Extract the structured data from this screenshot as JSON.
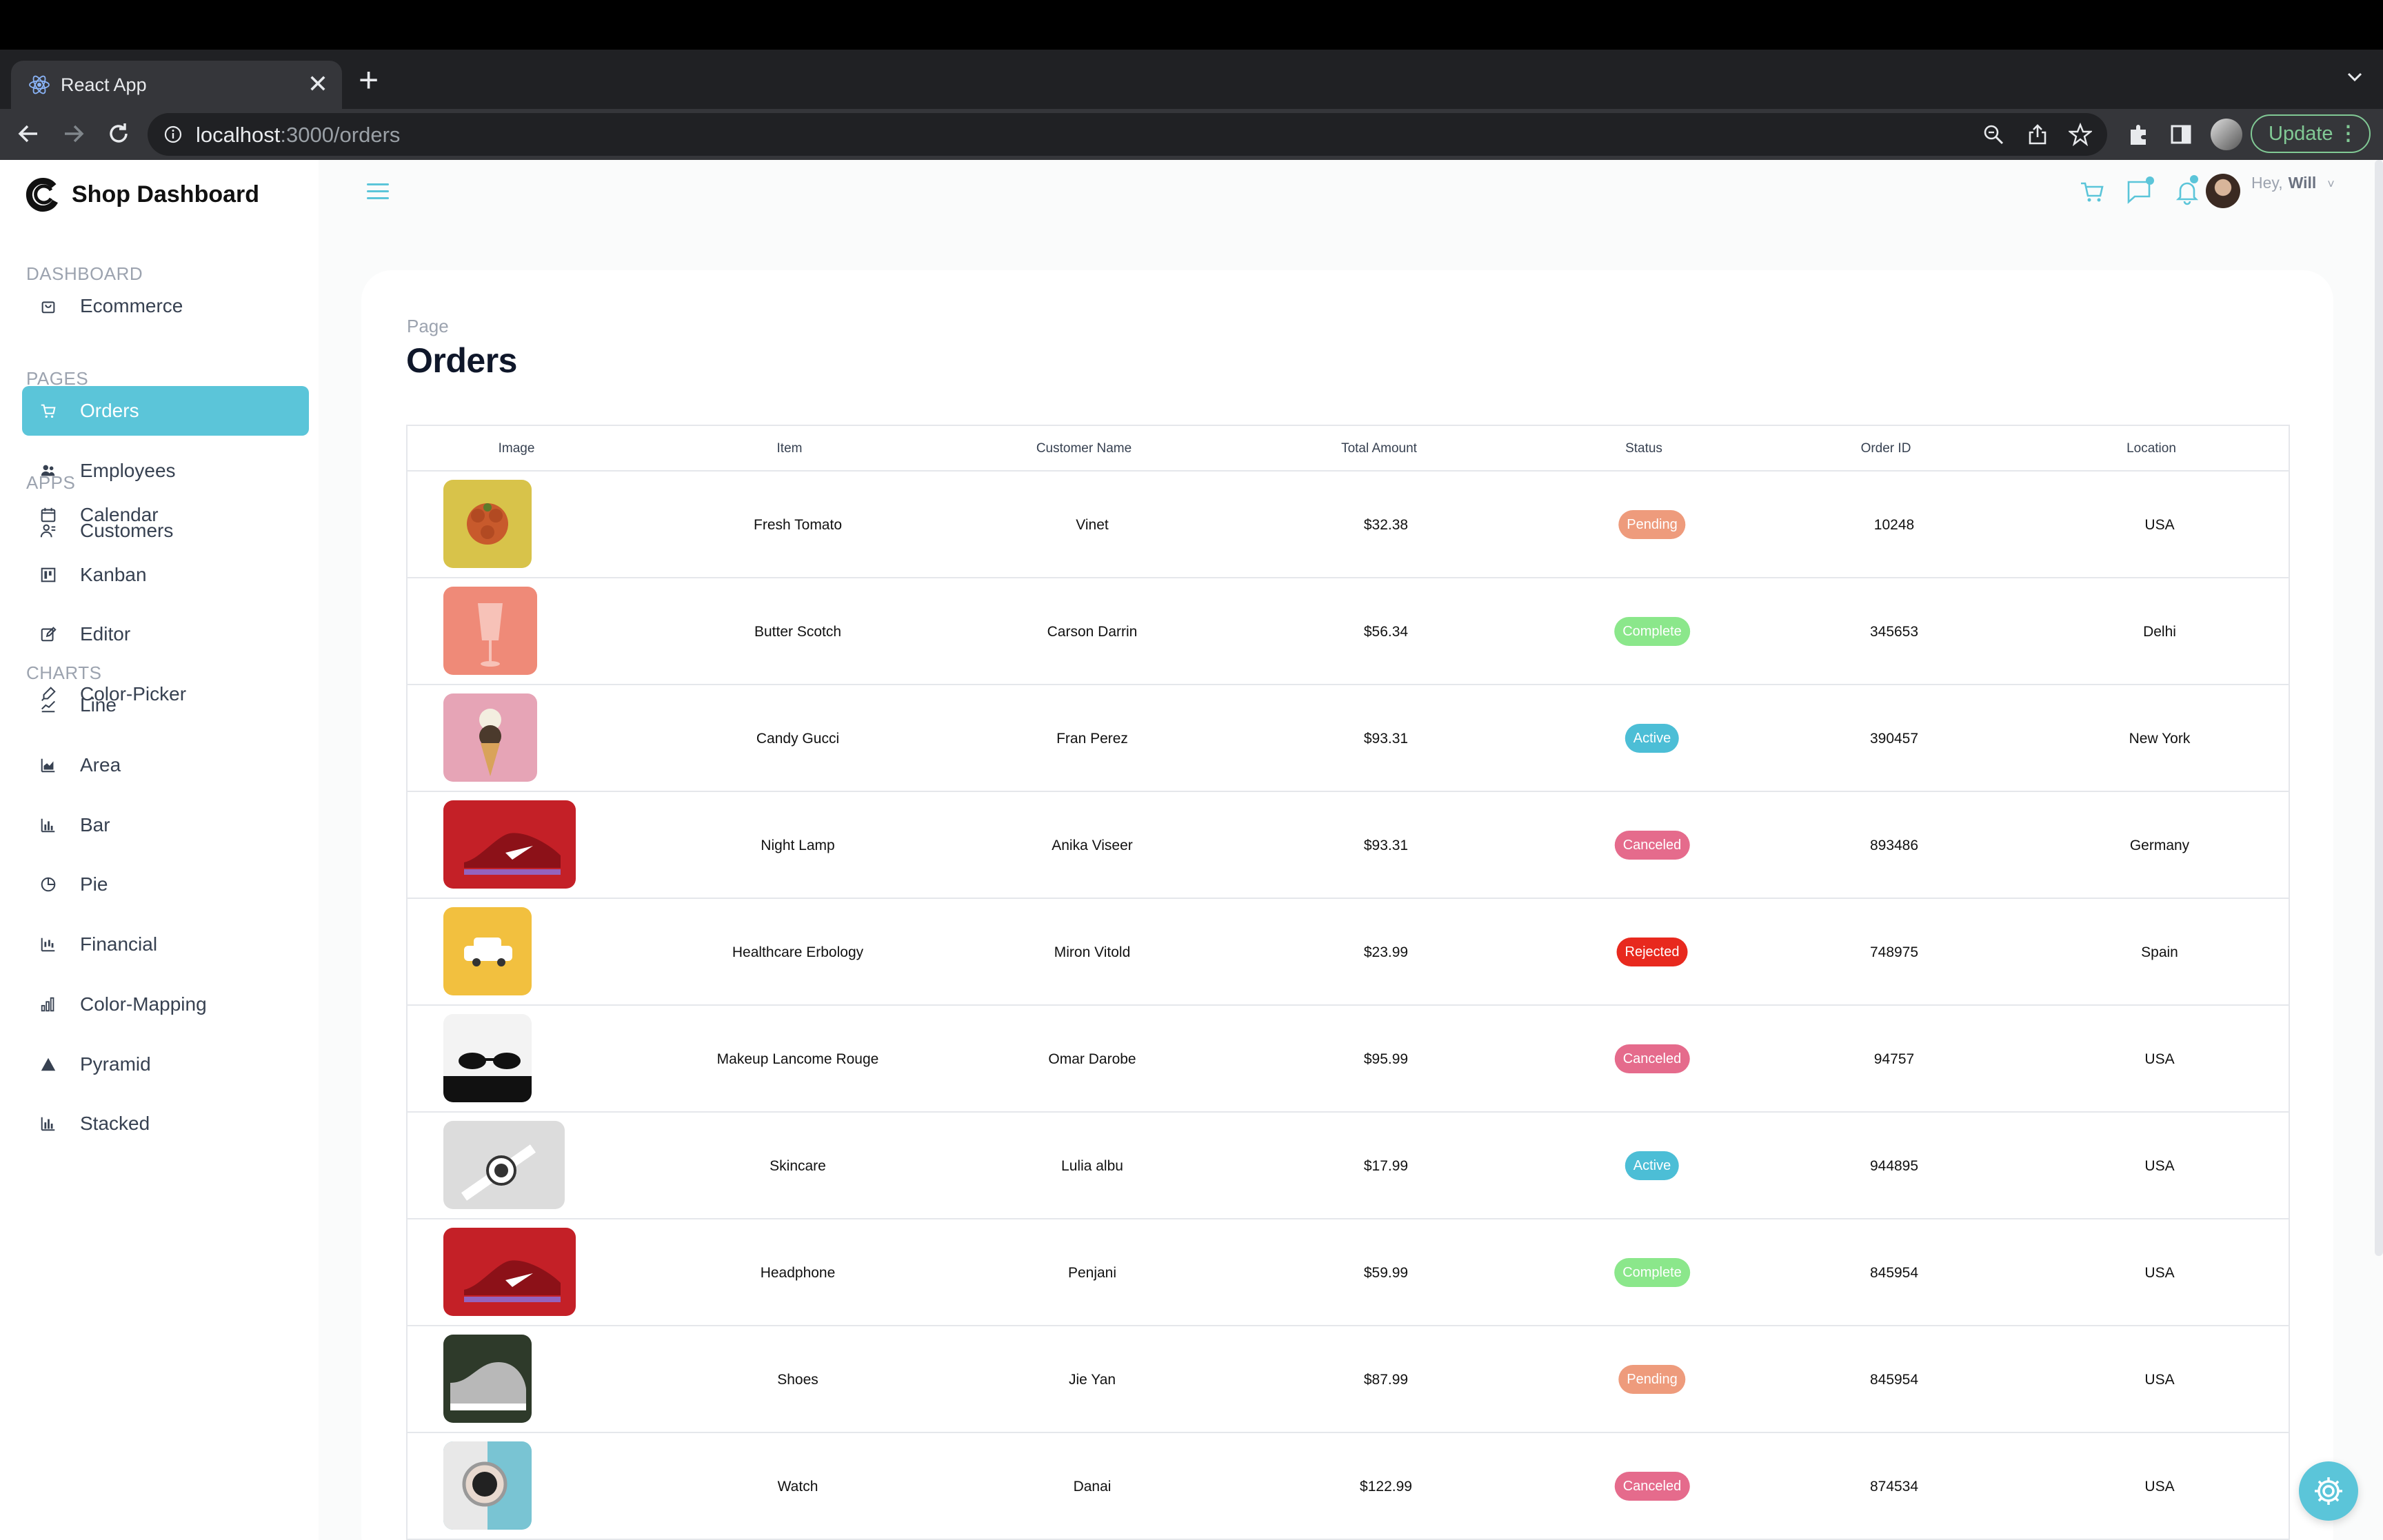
{
  "browser": {
    "tab_title": "React App",
    "tab_close": "✕",
    "new_tab": "+",
    "url_host": "localhost",
    "url_path": ":3000/orders",
    "update_label": "Update",
    "update_menu": "⋮"
  },
  "brand": {
    "name": "Shop Dashboard"
  },
  "sidebar": {
    "sections": [
      {
        "title": "DASHBOARD",
        "items": [
          {
            "label": "Ecommerce",
            "icon": "shopping-bag-icon"
          }
        ]
      },
      {
        "title": "PAGES",
        "items": [
          {
            "label": "Orders",
            "icon": "cart-icon",
            "active": true
          },
          {
            "label": "Employees",
            "icon": "employees-icon"
          },
          {
            "label": "Customers",
            "icon": "customers-icon"
          }
        ]
      },
      {
        "title": "APPS",
        "items": [
          {
            "label": "Calendar",
            "icon": "calendar-icon"
          },
          {
            "label": "Kanban",
            "icon": "kanban-icon"
          },
          {
            "label": "Editor",
            "icon": "editor-icon"
          },
          {
            "label": "Color-Picker",
            "icon": "color-picker-icon"
          }
        ]
      },
      {
        "title": "CHARTS",
        "items": [
          {
            "label": "Line",
            "icon": "line-chart-icon"
          },
          {
            "label": "Area",
            "icon": "area-chart-icon"
          },
          {
            "label": "Bar",
            "icon": "bar-chart-icon"
          },
          {
            "label": "Pie",
            "icon": "pie-chart-icon"
          },
          {
            "label": "Financial",
            "icon": "financial-icon"
          },
          {
            "label": "Color-Mapping",
            "icon": "color-mapping-icon"
          },
          {
            "label": "Pyramid",
            "icon": "pyramid-icon"
          },
          {
            "label": "Stacked",
            "icon": "stacked-icon"
          }
        ]
      }
    ]
  },
  "header": {
    "greeting": "Hey,",
    "user": "Will",
    "chevron": "˅"
  },
  "page": {
    "breadcrumb": "Page",
    "title": "Orders"
  },
  "table": {
    "columns": [
      "Image",
      "Item",
      "Customer Name",
      "Total Amount",
      "Status",
      "Order ID",
      "Location"
    ],
    "rows": [
      {
        "image": "tomato",
        "item": "Fresh Tomato",
        "customer": "Vinet",
        "amount": "$32.38",
        "status": "Pending",
        "order_id": "10248",
        "location": "USA"
      },
      {
        "image": "cup",
        "item": "Butter Scotch",
        "customer": "Carson Darrin",
        "amount": "$56.34",
        "status": "Complete",
        "order_id": "345653",
        "location": "Delhi"
      },
      {
        "image": "icecream",
        "item": "Candy Gucci",
        "customer": "Fran Perez",
        "amount": "$93.31",
        "status": "Active",
        "order_id": "390457",
        "location": "New York"
      },
      {
        "image": "sneaker-red",
        "item": "Night Lamp",
        "customer": "Anika Viseer",
        "amount": "$93.31",
        "status": "Canceled",
        "order_id": "893486",
        "location": "Germany"
      },
      {
        "image": "toy-car",
        "item": "Healthcare Erbology",
        "customer": "Miron Vitold",
        "amount": "$23.99",
        "status": "Rejected",
        "order_id": "748975",
        "location": "Spain"
      },
      {
        "image": "sunglasses",
        "item": "Makeup Lancome Rouge",
        "customer": "Omar Darobe",
        "amount": "$95.99",
        "status": "Canceled",
        "order_id": "94757",
        "location": "USA"
      },
      {
        "image": "smartwatch",
        "item": "Skincare",
        "customer": "Lulia albu",
        "amount": "$17.99",
        "status": "Active",
        "order_id": "944895",
        "location": "USA"
      },
      {
        "image": "sneaker-red",
        "item": "Headphone",
        "customer": "Penjani",
        "amount": "$59.99",
        "status": "Complete",
        "order_id": "845954",
        "location": "USA"
      },
      {
        "image": "shoe-grey",
        "item": "Shoes",
        "customer": "Jie Yan",
        "amount": "$87.99",
        "status": "Pending",
        "order_id": "845954",
        "location": "USA"
      },
      {
        "image": "watch",
        "item": "Watch",
        "customer": "Danai",
        "amount": "$122.99",
        "status": "Canceled",
        "order_id": "874534",
        "location": "USA"
      }
    ]
  },
  "status_colors": {
    "Pending": "#ee9b7c",
    "Complete": "#8be78b",
    "Active": "#4cbed6",
    "Canceled": "#e56b8c",
    "Rejected": "#e8291e"
  },
  "accent_color": "#5bc5d9"
}
